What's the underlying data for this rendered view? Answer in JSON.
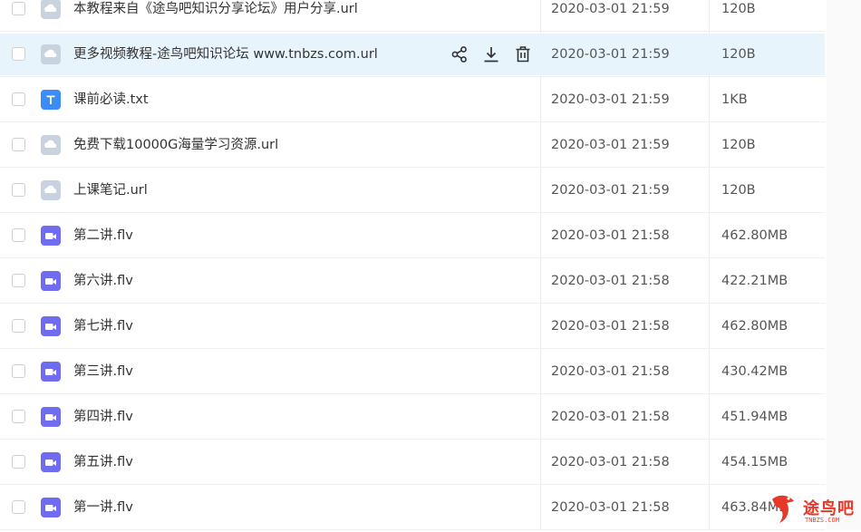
{
  "files": [
    {
      "name": "本教程来自《途鸟吧知识分享论坛》用户分享.url",
      "date": "2020-03-01 21:59",
      "size": "120B",
      "type": "url"
    },
    {
      "name": "更多视频教程-途鸟吧知识论坛 www.tnbzs.com.url",
      "date": "2020-03-01 21:59",
      "size": "120B",
      "type": "url"
    },
    {
      "name": "课前必读.txt",
      "date": "2020-03-01 21:59",
      "size": "1KB",
      "type": "txt"
    },
    {
      "name": "免费下载10000G海量学习资源.url",
      "date": "2020-03-01 21:59",
      "size": "120B",
      "type": "url"
    },
    {
      "name": "上课笔记.url",
      "date": "2020-03-01 21:59",
      "size": "120B",
      "type": "url"
    },
    {
      "name": "第二讲.flv",
      "date": "2020-03-01 21:58",
      "size": "462.80MB",
      "type": "video"
    },
    {
      "name": "第六讲.flv",
      "date": "2020-03-01 21:58",
      "size": "422.21MB",
      "type": "video"
    },
    {
      "name": "第七讲.flv",
      "date": "2020-03-01 21:58",
      "size": "462.80MB",
      "type": "video"
    },
    {
      "name": "第三讲.flv",
      "date": "2020-03-01 21:58",
      "size": "430.42MB",
      "type": "video"
    },
    {
      "name": "第四讲.flv",
      "date": "2020-03-01 21:58",
      "size": "451.94MB",
      "type": "video"
    },
    {
      "name": "第五讲.flv",
      "date": "2020-03-01 21:58",
      "size": "454.15MB",
      "type": "video"
    },
    {
      "name": "第一讲.flv",
      "date": "2020-03-01 21:58",
      "size": "463.84MB",
      "type": "video"
    }
  ],
  "hovered_row": 1,
  "row_actions": [
    "share-icon",
    "download-icon",
    "delete-icon"
  ],
  "watermark": {
    "text": "途鸟吧",
    "sub": "TNBZS.COM"
  },
  "colors": {
    "hover_bg": "#e8f4fc",
    "txt_icon": "#3b8cf5",
    "video_icon": "#6f6cf0",
    "url_icon": "#c9d3df",
    "watermark": "#e8382a"
  }
}
